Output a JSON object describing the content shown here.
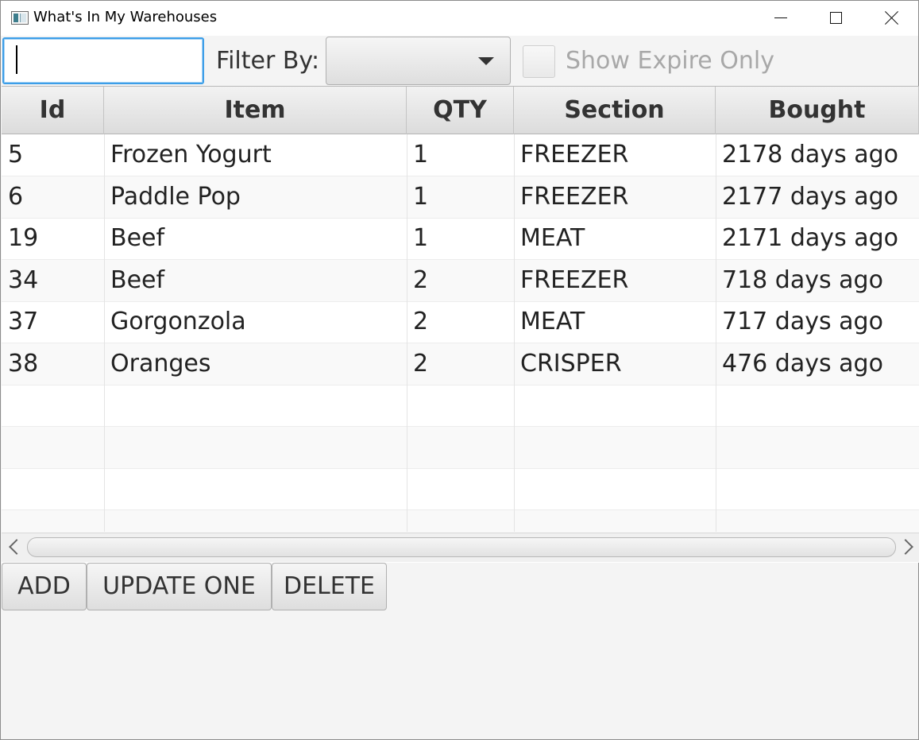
{
  "window": {
    "title": "What's In My Warehouses",
    "controls": [
      "minimize-icon",
      "maximize-icon",
      "close-icon"
    ]
  },
  "toolbar": {
    "search_value": "",
    "filter_label": "Filter By:",
    "filter_selected": "",
    "show_expire_label": "Show Expire Only",
    "show_expire_checked": false
  },
  "table": {
    "columns": [
      "Id",
      "Item",
      "QTY",
      "Section",
      "Bought"
    ],
    "rows": [
      {
        "id": "5",
        "item": "Frozen Yogurt",
        "qty": "1",
        "section": "FREEZER",
        "bought": "2178 days ago"
      },
      {
        "id": "6",
        "item": "Paddle Pop",
        "qty": "1",
        "section": "FREEZER",
        "bought": "2177 days ago"
      },
      {
        "id": "19",
        "item": "Beef",
        "qty": "1",
        "section": "MEAT",
        "bought": "2171 days ago"
      },
      {
        "id": "34",
        "item": "Beef",
        "qty": "2",
        "section": "FREEZER",
        "bought": "718 days ago"
      },
      {
        "id": "37",
        "item": "Gorgonzola",
        "qty": "2",
        "section": "MEAT",
        "bought": "717 days ago"
      },
      {
        "id": "38",
        "item": "Oranges",
        "qty": "2",
        "section": "CRISPER",
        "bought": "476 days ago"
      }
    ]
  },
  "actions": {
    "add": "ADD",
    "update_one": "UPDATE ONE",
    "delete": "DELETE"
  },
  "colors": {
    "focus_accent": "#3c9ee8",
    "background": "#f4f4f4"
  }
}
